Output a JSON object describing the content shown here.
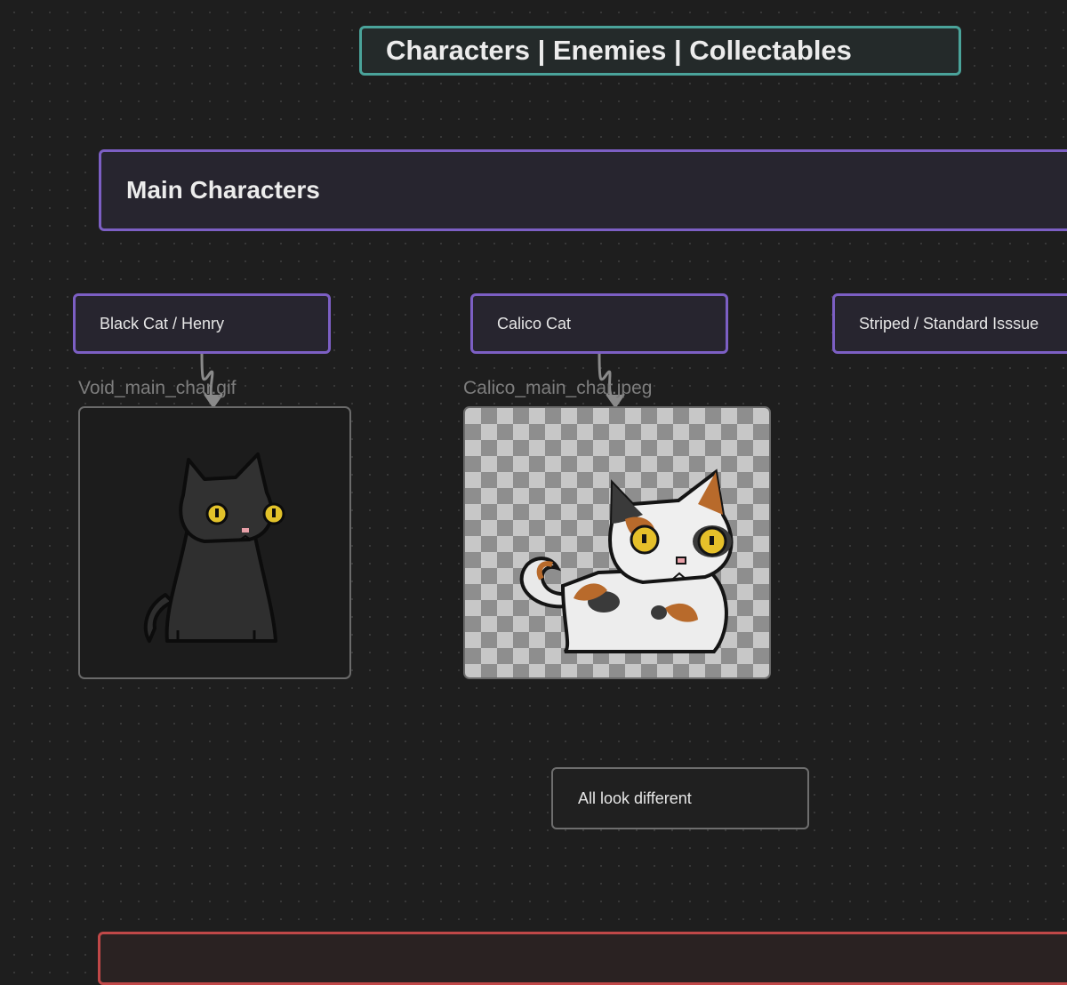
{
  "canvas": {
    "title": "Characters | Enemies | Collectables",
    "section_title": "Main Characters",
    "characters": [
      {
        "label": "Black Cat / Henry"
      },
      {
        "label": "Calico Cat"
      },
      {
        "label": "Striped / Standard Isssue"
      }
    ],
    "images": [
      {
        "file": "Void_main_char.gif",
        "subject": "black-cat-sprite"
      },
      {
        "file": "Calico_main_char.jpeg",
        "subject": "calico-cat-sprite"
      }
    ],
    "note": "All look different"
  },
  "colors": {
    "background": "#1e1e1e",
    "title_border": "#4aa39a",
    "section_border": "#7c5fc4",
    "note_border": "#6e6e6e",
    "bottom_border": "#c04848"
  }
}
